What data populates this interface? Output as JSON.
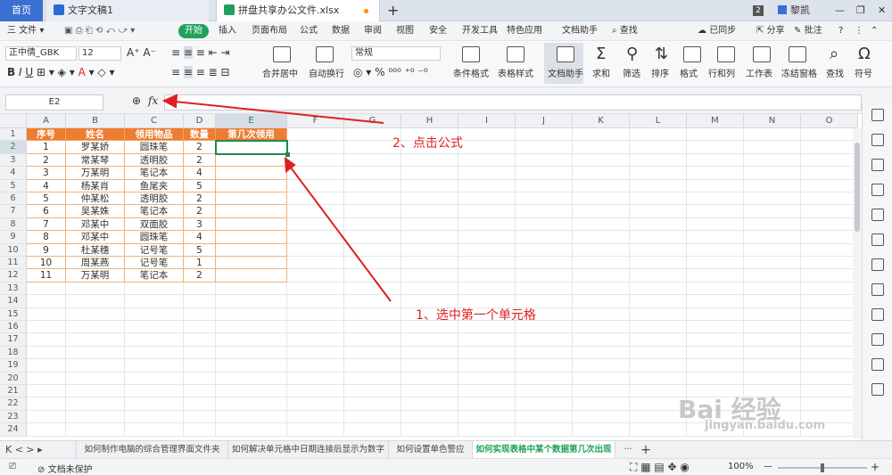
{
  "tabs": {
    "home": "首页",
    "doc": "文字文稿1",
    "xls": "拼盘共享办公文件.xlsx",
    "new_tab": "+",
    "count_badge": "2",
    "user": "黎凯"
  },
  "menu": {
    "file": "三 文件 ▾",
    "items": [
      "开始",
      "插入",
      "页面布局",
      "公式",
      "数据",
      "审阅",
      "视图",
      "安全",
      "开发工具",
      "特色应用",
      "文档助手"
    ],
    "search": "查找",
    "sync": "已同步",
    "share": "分享",
    "comment": "批注"
  },
  "ribbon": {
    "font_name": "正中倩_GBK",
    "font_size": "12",
    "number_format": "常规",
    "merge": "合并居中",
    "wrap": "自动换行",
    "cond_format": "条件格式",
    "table_style": "表格样式",
    "doc_helper": "文档助手",
    "sum": "求和",
    "filter": "筛选",
    "sort": "排序",
    "format": "格式",
    "rowcol": "行和列",
    "sheet": "工作表",
    "freeze": "冻结窗格",
    "find": "查找",
    "symbol": "符号"
  },
  "formula_bar": {
    "cell_ref": "E2",
    "fx": "fx",
    "content": ""
  },
  "sheet": {
    "columns": [
      "A",
      "B",
      "C",
      "D",
      "E",
      "F",
      "G",
      "H",
      "I",
      "J",
      "K",
      "L",
      "M",
      "N",
      "O"
    ],
    "row_numbers": [
      "1",
      "2",
      "3",
      "4",
      "5",
      "6",
      "7",
      "8",
      "9",
      "10",
      "11",
      "12",
      "13",
      "14",
      "15",
      "16",
      "17",
      "18",
      "19",
      "20",
      "21",
      "22",
      "23",
      "24"
    ],
    "headers": [
      "序号",
      "姓名",
      "领用物品",
      "数量",
      "第几次领用"
    ],
    "rows": [
      [
        "1",
        "罗某娇",
        "圆珠笔",
        "2",
        ""
      ],
      [
        "2",
        "常某琴",
        "透明胶",
        "2",
        ""
      ],
      [
        "3",
        "万某明",
        "笔记本",
        "4",
        ""
      ],
      [
        "4",
        "杨某肖",
        "鱼尾夹",
        "5",
        ""
      ],
      [
        "5",
        "仲某松",
        "透明胶",
        "2",
        ""
      ],
      [
        "6",
        "吴某姝",
        "笔记本",
        "2",
        ""
      ],
      [
        "7",
        "邓某中",
        "双面胶",
        "3",
        ""
      ],
      [
        "8",
        "邓某中",
        "圆珠笔",
        "4",
        ""
      ],
      [
        "9",
        "杜某穗",
        "记号笔",
        "5",
        ""
      ],
      [
        "10",
        "周某燕",
        "记号笔",
        "1",
        ""
      ],
      [
        "11",
        "万某明",
        "笔记本",
        "2",
        ""
      ]
    ]
  },
  "sheet_tabs": {
    "items": [
      "如何制作电脑的综合管理界面文件夹",
      "如何解决单元格中日期连接后显示为数字",
      "如何设置单色警应",
      "如何实现表格中某个数据第几次出现"
    ],
    "more": "···",
    "add": "+"
  },
  "status": {
    "protect": "文档未保护",
    "zoom": "100%",
    "minus": "—",
    "plus": "+"
  },
  "annotations": {
    "step1": "1、选中第一个单元格",
    "step2": "2、点击公式"
  },
  "watermark": {
    "text": "Bai 经验",
    "url": "jingyan.baidu.com"
  },
  "colors": {
    "header_orange": "#ed7d31",
    "accent_green": "#1fa15a",
    "annotation_red": "#e02020"
  }
}
